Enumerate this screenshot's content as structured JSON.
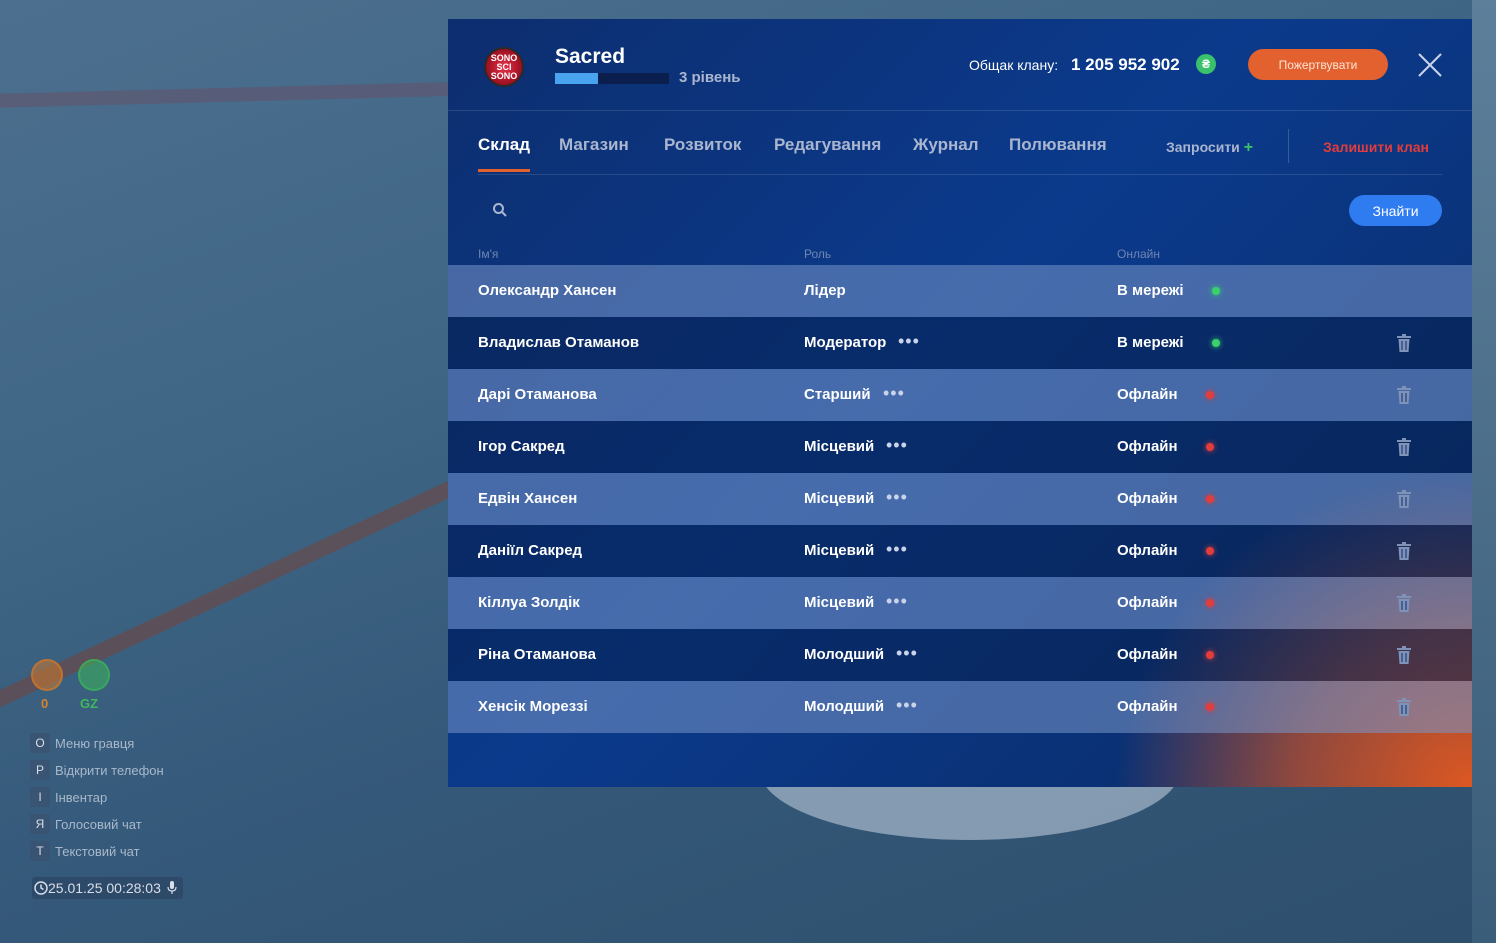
{
  "clan": {
    "name": "Sacred",
    "logo_text": "SONO SCI SONO",
    "level_label": "3 рівень",
    "level_progress": 0.38
  },
  "treasury": {
    "label": "Общак клану:",
    "value": "1 205 952 902",
    "currency_icon": "coin-icon"
  },
  "header": {
    "donate_label": "Пожертвувати",
    "close_icon": "close-icon"
  },
  "tabs": [
    {
      "label": "Склад",
      "active": true
    },
    {
      "label": "Магазин",
      "active": false
    },
    {
      "label": "Розвиток",
      "active": false
    },
    {
      "label": "Редагування",
      "active": false
    },
    {
      "label": "Журнал",
      "active": false
    },
    {
      "label": "Полювання",
      "active": false
    }
  ],
  "actions": {
    "invite_label": "Запросити",
    "invite_plus": "+",
    "leave_label": "Залишити клан"
  },
  "search": {
    "placeholder": "",
    "value": "",
    "find_label": "Знайти"
  },
  "columns": {
    "name": "Ім'я",
    "role": "Роль",
    "online": "Онлайн"
  },
  "members": [
    {
      "name": "Олександр Хансен",
      "role": "Лідер",
      "status": "В мережі",
      "online": true,
      "menu": false,
      "delete": false
    },
    {
      "name": "Владислав Отаманов",
      "role": "Модератор",
      "status": "В мережі",
      "online": true,
      "menu": true,
      "delete": true
    },
    {
      "name": "Дарі Отаманова",
      "role": "Старший",
      "status": "Офлайн",
      "online": false,
      "menu": true,
      "delete": true
    },
    {
      "name": "Ігор Сакред",
      "role": "Місцевий",
      "status": "Офлайн",
      "online": false,
      "menu": true,
      "delete": true
    },
    {
      "name": "Едвін Хансен",
      "role": "Місцевий",
      "status": "Офлайн",
      "online": false,
      "menu": true,
      "delete": true
    },
    {
      "name": "Даніїл Сакред",
      "role": "Місцевий",
      "status": "Офлайн",
      "online": false,
      "menu": true,
      "delete": true
    },
    {
      "name": "Кіллуа Золдік",
      "role": "Місцевий",
      "status": "Офлайн",
      "online": false,
      "menu": true,
      "delete": true
    },
    {
      "name": "Ріна Отаманова",
      "role": "Молодший",
      "status": "Офлайн",
      "online": false,
      "menu": true,
      "delete": true
    },
    {
      "name": "Хенсік Мореззі",
      "role": "Молодший",
      "status": "Офлайн",
      "online": false,
      "menu": true,
      "delete": true
    }
  ],
  "hud": {
    "hunger_value": "0",
    "zone_label": "GZ",
    "hints": [
      {
        "key": "O",
        "label": "Меню гравця"
      },
      {
        "key": "P",
        "label": "Відкрити телефон"
      },
      {
        "key": "I",
        "label": "Інвентар"
      },
      {
        "key": "Я",
        "label": "Голосовий чат"
      },
      {
        "key": "T",
        "label": "Текстовий чат"
      }
    ],
    "datetime": "25.01.25 00:28:03"
  },
  "colors": {
    "accent_orange": "#e2612e",
    "accent_blue": "#2f7cf0",
    "online_green": "#39d16b",
    "offline_red": "#e23c3c",
    "leave_red": "#e23c3c"
  }
}
